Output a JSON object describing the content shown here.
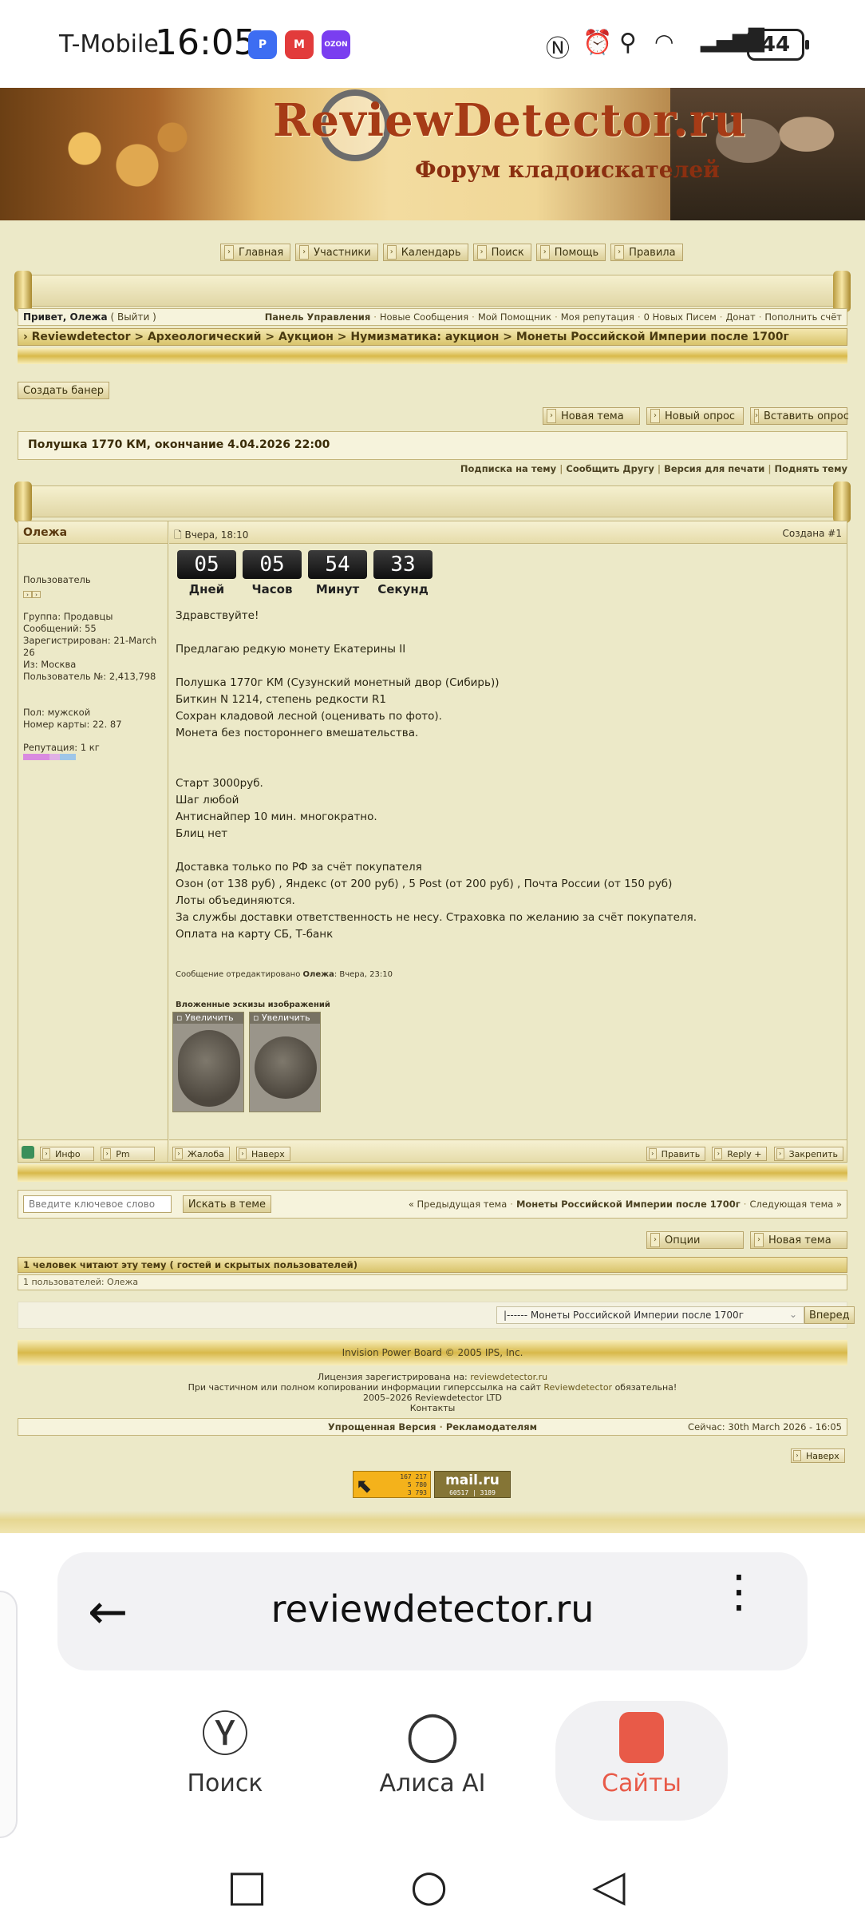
{
  "status": {
    "carrier": "T-Mobile",
    "time": "16:05",
    "app_icons": [
      "P",
      "M",
      "OZON"
    ],
    "battery": "44"
  },
  "banner": {
    "title": "ReviewDetector.ru",
    "subtitle": "Форум кладоискателей"
  },
  "nav": [
    "Главная",
    "Участники",
    "Календарь",
    "Поиск",
    "Помощь",
    "Правила"
  ],
  "userbar": {
    "greeting": "Привет, Олежа",
    "logout": "( Выйти )",
    "links": [
      "Панель Управления",
      "Новые Сообщения",
      "Мой Помощник",
      "Моя репутация",
      "0 Новых Писем",
      "Донат",
      "Пополнить счёт"
    ]
  },
  "breadcrumb": "› Reviewdetector > Археологический > Аукцион > Нумизматика: аукцион > Монеты Российской Империи после 1700г",
  "create_banner": "Создать банер",
  "topic_actions": [
    "Новая тема",
    "Новый опрос",
    "Вставить опрос"
  ],
  "topic_title": "Полушка 1770 КМ, окончание 4.04.2026 22:00",
  "topic_links": [
    "Подписка на тему",
    "Сообщить Другу",
    "Версия для печати",
    "Поднять тему"
  ],
  "post": {
    "author": "Олежа",
    "date": "Вчера, 18:10",
    "created": "Создана #1",
    "user_info": {
      "role": "Пользователь",
      "group": "Группа: Продавцы",
      "messages": "Сообщений: 55",
      "registered": "Зарегистрирован: 21-March 26",
      "from": "Из: Москва",
      "user_no": "Пользователь №: 2,413,798",
      "sex": "Пол: мужской",
      "card": "Номер карты: 22. 87",
      "reputation": "Репутация: 1 кг"
    },
    "timer": [
      {
        "value": "05",
        "label": "Дней"
      },
      {
        "value": "05",
        "label": "Часов"
      },
      {
        "value": "54",
        "label": "Минут"
      },
      {
        "value": "33",
        "label": "Секунд"
      }
    ],
    "lines": [
      "Здравствуйте!",
      "",
      "Предлагаю редкую монету Екатерины II",
      "",
      "Полушка 1770г КМ (Сузунский монетный двор (Сибирь))",
      "Биткин N 1214, степень редкости R1",
      "Сохран кладовой лесной (оценивать по фото).",
      "Монета без постороннего вмешательства.",
      "",
      "",
      "Старт 3000руб.",
      "Шаг любой",
      "Антиснайпер 10 мин. многократно.",
      "Блиц нет",
      "",
      "Доставка только по РФ за счёт покупателя",
      "Озон (от 138 руб) , Яндекс (от 200 руб) , 5 Post (от 200 руб) , Почта России (от 150 руб)",
      "Лоты объединяются.",
      "За службы доставки ответственность не несу. Страховка по желанию за счёт покупателя.",
      "Оплата на карту СБ, Т-банк"
    ],
    "edited": "Сообщение отредактировано",
    "edited_by": "Олежа",
    "edited_when": ": Вчера, 23:10",
    "attach_title": "Вложенные эскизы изображений",
    "thumb_label": "Увеличить",
    "left_buttons": [
      "Инфо",
      "Pm"
    ],
    "mid_buttons": [
      "Жалоба",
      "Наверх"
    ],
    "right_buttons": [
      "Править",
      "Reply +",
      "Закрепить"
    ]
  },
  "search": {
    "placeholder": "Введите ключевое слово",
    "button": "Искать в теме",
    "prev": "« Предыдущая тема",
    "current": "Монеты Российской Империи после 1700г",
    "next": "Следующая тема »"
  },
  "bottom_actions": [
    "Опции",
    "Новая тема"
  ],
  "readers": {
    "title": "1 человек читают эту тему ( гостей и скрытых пользователей)",
    "list": "1 пользователей: Олежа"
  },
  "jump": {
    "selected": "|------ Монеты Российской Империи после 1700г",
    "button": "Вперед"
  },
  "footer": {
    "copyright": "Invision Power Board © 2005  IPS, Inc.",
    "license_prefix": "Лицензия зарегистрирована на:",
    "license_site": "reviewdetector.ru",
    "copy_note_a": "При частичном или полном копировании информации гиперссылка на сайт",
    "copy_note_site": "Reviewdetector",
    "copy_note_b": "обязательна!",
    "years": "2005–2026 Reviewdetector LTD",
    "contacts": "Контакты",
    "simple": "Упрощенная Версия",
    "ads": "Рекламодателям",
    "now": "Сейчас: 30th March 2026 - 16:05",
    "up": "Наверх",
    "counter1": [
      "167 217",
      "5 780",
      "3 793"
    ],
    "counter2_brand": "mail.ru",
    "counter2_nums": "60517 | 3189"
  },
  "browser": {
    "url": "reviewdetector.ru",
    "tabs": [
      "Поиск",
      "Алиса AI",
      "Сайты"
    ]
  }
}
